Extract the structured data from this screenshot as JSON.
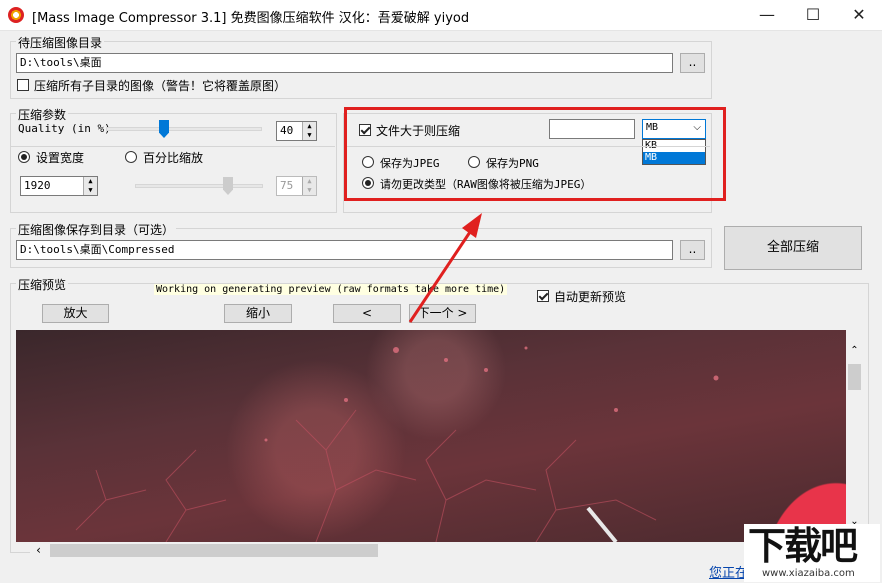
{
  "window": {
    "title": "[Mass Image Compressor 3.1] 免费图像压缩软件 汉化：吾爱破解 yiyod",
    "minimize": "—",
    "maximize": "☐",
    "close": "✕"
  },
  "source": {
    "group_label": "待压缩图像目录",
    "path": "D:\\tools\\桌面",
    "browse": "..",
    "subdir_label": "压缩所有子目录的图像（警告！它将覆盖原图）"
  },
  "params": {
    "group_label": "压缩参数",
    "quality_label": "Quality (in %)",
    "quality_value": "40",
    "quality_level": 40,
    "set_width_label": "设置宽度",
    "percent_label": "百分比缩放",
    "width_value": "1920",
    "percent_value": "75"
  },
  "options": {
    "larger_label": "文件大于则压缩",
    "size_value": "",
    "unit_selected": "MB",
    "unit_options": [
      "KB",
      "MB"
    ],
    "save_jpeg": "保存为JPEG",
    "save_png": "保存为PNG",
    "keep_type": "请勿更改类型（RAW图像将被压缩为JPEG）"
  },
  "output": {
    "group_label": "压缩图像保存到目录（可选）",
    "path": "D:\\tools\\桌面\\Compressed",
    "browse": "..",
    "compress_all": "全部压缩"
  },
  "preview": {
    "group_label": "压缩预览",
    "status": "Working on generating preview (raw formats take more time)",
    "zoom_in": "放大",
    "zoom_out": "缩小",
    "prev": "<",
    "next": "下一个 >",
    "auto_update": "自动更新预览"
  },
  "footer": {
    "link_partial": "您正在"
  },
  "watermark": {
    "text": "下载吧",
    "url": "www.xiazaiba.com"
  },
  "colors": {
    "annotation_red": "#e0201f",
    "select_highlight": "#0078d7",
    "preview_accent": "#e8344a"
  }
}
